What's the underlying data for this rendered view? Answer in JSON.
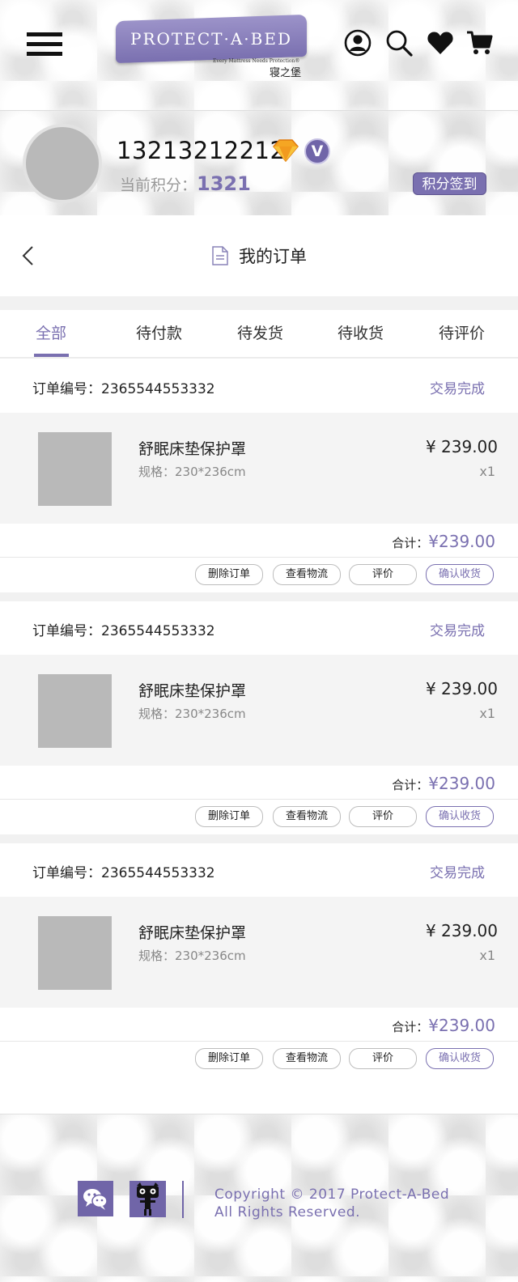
{
  "header": {
    "logo_text": "PROTECT·A·BED",
    "logo_tagline": "Every Mattress Needs Protection®",
    "logo_cn": "寝之堡"
  },
  "profile": {
    "phone": "13213212212",
    "points_label": "当前积分：",
    "points_value": "1321",
    "sign_in_label": "积分签到"
  },
  "title_bar": {
    "title": "我的订单"
  },
  "tabs": [
    {
      "label": "全部",
      "active": true
    },
    {
      "label": "待付款"
    },
    {
      "label": "待发货"
    },
    {
      "label": "待收货"
    },
    {
      "label": "待评价"
    }
  ],
  "orders": [
    {
      "order_no": "订单编号：2365544553332",
      "status": "交易完成",
      "product_name": "舒眠床垫保护罩",
      "spec": "规格：230*236cm",
      "price": "¥ 239.00",
      "qty": "x1",
      "total_label": "合计：",
      "total_value": "¥239.00",
      "actions": [
        "删除订单",
        "查看物流",
        "评价",
        "确认收货"
      ]
    },
    {
      "order_no": "订单编号：2365544553332",
      "status": "交易完成",
      "product_name": "舒眠床垫保护罩",
      "spec": "规格：230*236cm",
      "price": "¥ 239.00",
      "qty": "x1",
      "total_label": "合计：",
      "total_value": "¥239.00",
      "actions": [
        "删除订单",
        "查看物流",
        "评价",
        "确认收货"
      ]
    },
    {
      "order_no": "订单编号：2365544553332",
      "status": "交易完成",
      "product_name": "舒眠床垫保护罩",
      "spec": "规格：230*236cm",
      "price": "¥ 239.00",
      "qty": "x1",
      "total_label": "合计：",
      "total_value": "¥239.00",
      "actions": [
        "删除订单",
        "查看物流",
        "评价",
        "确认收货"
      ]
    }
  ],
  "footer": {
    "copyright_line1": "Copyright  © 2017 Protect-A-Bed",
    "copyright_line2": "All Rights Reserved."
  },
  "colors": {
    "accent": "#7a70b0",
    "brand_dark": "#7065a8",
    "diamond": "#f5a623"
  },
  "icons": [
    "menu-icon",
    "user-icon",
    "search-icon",
    "heart-icon",
    "cart-icon",
    "diamond-icon",
    "vip-icon",
    "back-icon",
    "document-icon",
    "wechat-icon",
    "tmall-icon"
  ]
}
